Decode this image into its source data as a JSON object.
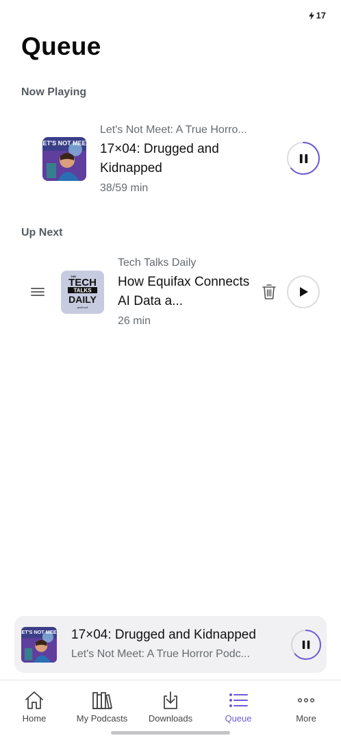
{
  "status": {
    "battery": "17"
  },
  "page": {
    "title": "Queue"
  },
  "sections": {
    "now_playing": "Now Playing",
    "up_next": "Up Next"
  },
  "now_playing": {
    "podcast": "Let's Not Meet: A True Horro...",
    "title": "17×04: Drugged and Kidnapped",
    "meta": "38/59 min",
    "progress": 0.64,
    "artwork_text": "LET'S NOT MEET"
  },
  "up_next": [
    {
      "podcast": "Tech Talks Daily",
      "title": "How Equifax Connects AI Data a...",
      "meta": "26 min",
      "artwork_text": [
        "THE",
        "TECH",
        "TALKS",
        "DAILY",
        "podcast"
      ]
    }
  ],
  "mini_player": {
    "title": "17×04: Drugged and Kidnapped",
    "subtitle": "Let's Not Meet: A True Horror Podc...",
    "progress": 0.64
  },
  "tabs": [
    {
      "label": "Home",
      "icon": "home-icon",
      "active": false
    },
    {
      "label": "My Podcasts",
      "icon": "library-icon",
      "active": false
    },
    {
      "label": "Downloads",
      "icon": "download-icon",
      "active": false
    },
    {
      "label": "Queue",
      "icon": "queue-icon",
      "active": true
    },
    {
      "label": "More",
      "icon": "more-icon",
      "active": false
    }
  ],
  "colors": {
    "accent": "#6b5bd6",
    "text": "#111111",
    "muted": "#666b70"
  }
}
